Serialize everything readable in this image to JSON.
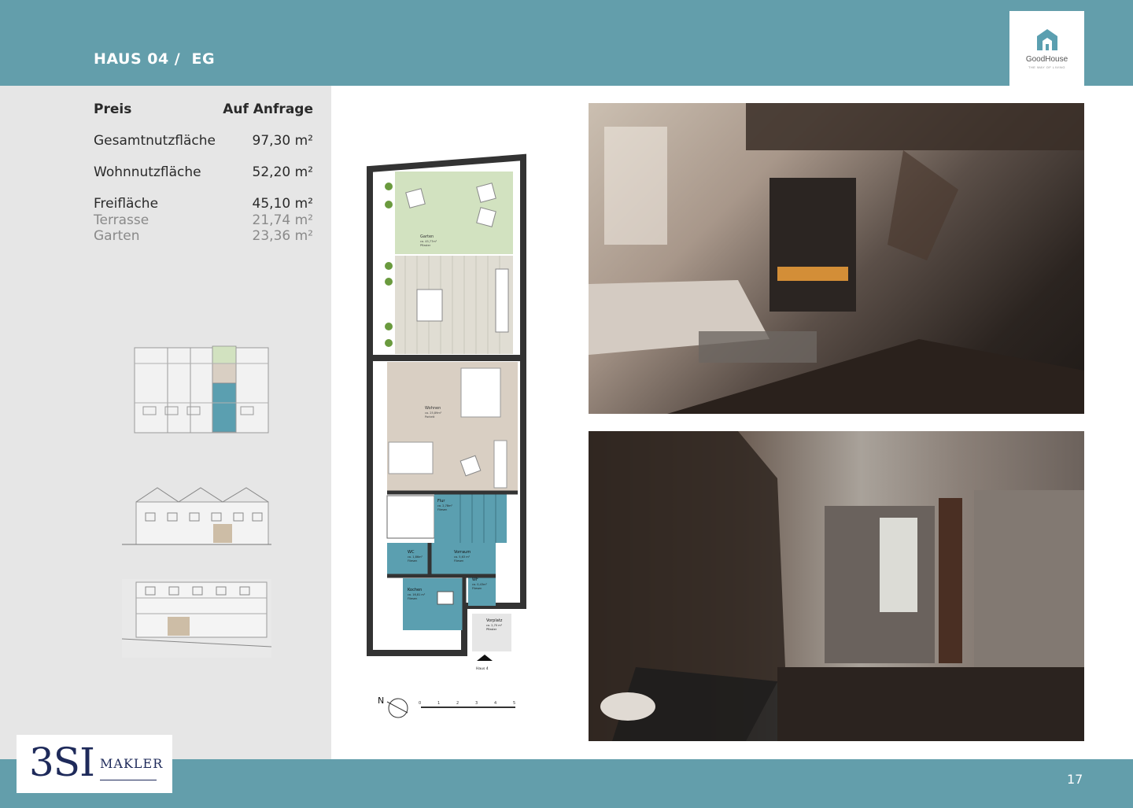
{
  "header": {
    "title": "HAUS 04 /  EG"
  },
  "logo": {
    "name": "GoodHouse",
    "tagline": "THE WAY OF LIVING"
  },
  "specs": {
    "price_label": "Preis",
    "price_value": "Auf Anfrage",
    "gesamt_label": "Gesamtnutzfläche",
    "gesamt_value": "97,30 m²",
    "wohn_label": "Wohnnutzfläche",
    "wohn_value": "52,20 m²",
    "frei_label": "Freifläche",
    "frei_value": "45,10 m²",
    "terrasse_label": "Terrasse",
    "terrasse_value": "21,74 m²",
    "garten_label": "Garten",
    "garten_value": "23,36 m²"
  },
  "plan": {
    "garten": "Garten",
    "garten_area": "ca. 45,77m²",
    "garten_floor": "Pflaster",
    "wohnen": "Wohnen",
    "wohnen_area": "ca. 25,89m²",
    "wohnen_floor": "Parkett",
    "flur": "Flur",
    "flur_area": "ca. 2,78m²",
    "flur_floor": "Fliesen",
    "wc": "WC",
    "wc_area": "ca. 1,86m²",
    "wc_floor": "Fliesen",
    "vorraum": "Vorraum",
    "vorraum_area": "ca. 5,63 m²",
    "vorraum_floor": "Fliesen",
    "wf": "WF",
    "wf_area": "ca. 0,43m²",
    "wf_floor": "Fliesen",
    "kochen": "Kochen",
    "kochen_area": "ca. 16,81 m²",
    "kochen_floor": "Fliesen",
    "vorplatz": "Vorplatz",
    "vorplatz_area": "ca. 2,70 m²",
    "vorplatz_floor": "Pflaster",
    "entrance": "Haus 4",
    "compass": "N",
    "scale": [
      "0",
      "1",
      "2",
      "3",
      "4",
      "5"
    ]
  },
  "footer": {
    "brand_big": "3SI",
    "brand_small": "MAKLER",
    "page": "17"
  },
  "colors": {
    "bar": "#639eab",
    "sidebar": "#e6e6e6",
    "garden": "#d2e2c0",
    "room": "#d9cfc3",
    "wet": "#5b9fb0",
    "navy": "#1e2a5a"
  }
}
